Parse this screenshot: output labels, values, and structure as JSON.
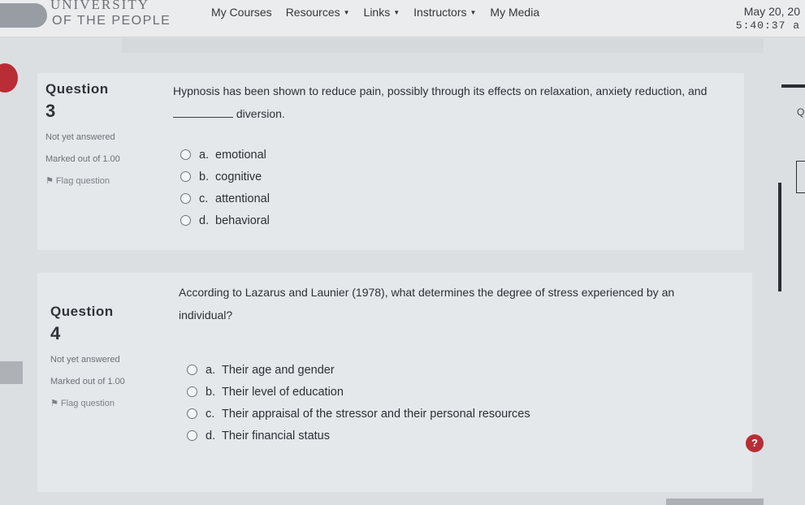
{
  "header": {
    "logo_line1": "UNIVERSITY",
    "logo_line2": "OF THE PEOPLE",
    "nav": [
      {
        "label": "My Courses",
        "dropdown": false
      },
      {
        "label": "Resources",
        "dropdown": true
      },
      {
        "label": "Links",
        "dropdown": true
      },
      {
        "label": "Instructors",
        "dropdown": true
      },
      {
        "label": "My Media",
        "dropdown": false
      }
    ],
    "date": "May 20, 20",
    "time": "5:40:37 a"
  },
  "questions": [
    {
      "label": "Question",
      "number": "3",
      "status": "Not yet answered",
      "marks": "Marked out of 1.00",
      "flag": "Flag question",
      "text_before": "Hypnosis has been shown to reduce pain, possibly through its effects on relaxation, anxiety reduction, and",
      "text_after": "diversion.",
      "options": [
        {
          "letter": "a.",
          "text": "emotional"
        },
        {
          "letter": "b.",
          "text": "cognitive"
        },
        {
          "letter": "c.",
          "text": "attentional"
        },
        {
          "letter": "d.",
          "text": "behavioral"
        }
      ]
    },
    {
      "label": "Question",
      "number": "4",
      "status": "Not yet answered",
      "marks": "Marked out of 1.00",
      "flag": "Flag question",
      "text_before": "According to Lazarus and Launier (1978), what determines the degree of stress experienced by an individual?",
      "text_after": "",
      "options": [
        {
          "letter": "a.",
          "text": "Their age and gender"
        },
        {
          "letter": "b.",
          "text": "Their level of education"
        },
        {
          "letter": "c.",
          "text": "Their appraisal of the stressor and their personal resources"
        },
        {
          "letter": "d.",
          "text": "Their financial status"
        }
      ]
    }
  ],
  "help_label": "?",
  "right_edge_label": "Q",
  "colors": {
    "accent": "#b82d36",
    "card": "#e5e8ea",
    "background": "#dcdfe2"
  }
}
